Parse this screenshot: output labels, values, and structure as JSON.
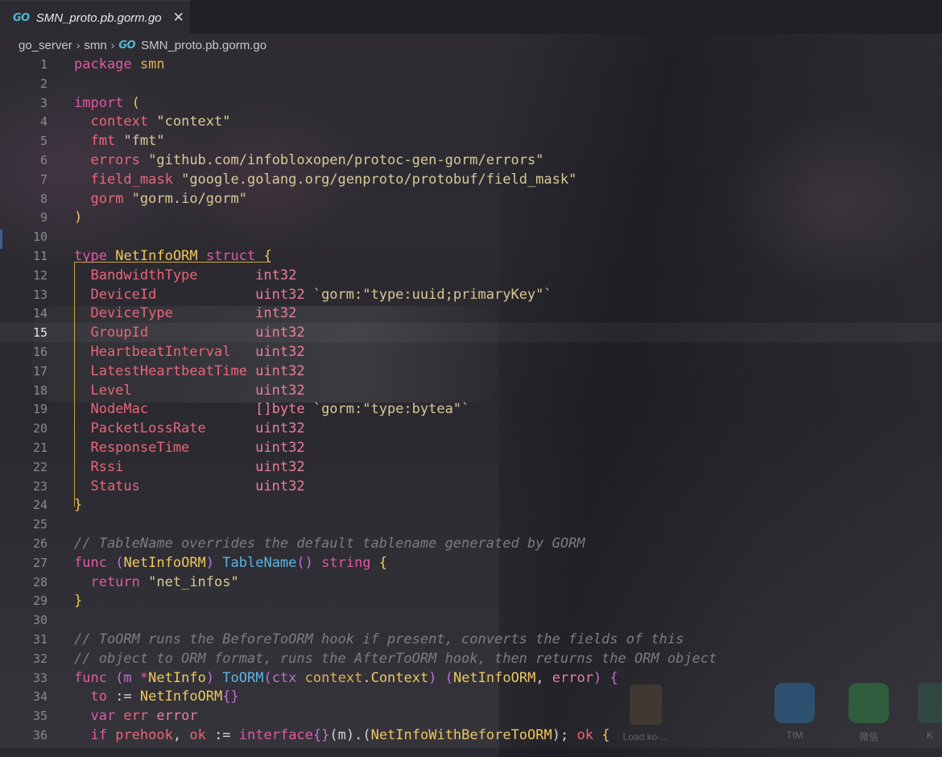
{
  "tab": {
    "icon": "go-file-icon",
    "label": "SMN_proto.pb.gorm.go",
    "close_label": "✕"
  },
  "breadcrumb": {
    "parts": [
      "go_server",
      "smn",
      "SMN_proto.pb.gorm.go"
    ]
  },
  "editor": {
    "active_line": 15,
    "line_numbers": [
      "1",
      "2",
      "3",
      "4",
      "5",
      "6",
      "7",
      "8",
      "9",
      "10",
      "11",
      "12",
      "13",
      "14",
      "15",
      "16",
      "17",
      "18",
      "19",
      "20",
      "21",
      "22",
      "23",
      "24",
      "25",
      "26",
      "27",
      "28",
      "29",
      "30",
      "31",
      "32",
      "33",
      "34",
      "35",
      "36"
    ]
  },
  "code": {
    "l1": [
      "package",
      " ",
      "smn"
    ],
    "l3": [
      "import",
      " ",
      "("
    ],
    "l4": [
      "  context",
      " ",
      "\"context\""
    ],
    "l5": [
      "  fmt",
      " ",
      "\"fmt\""
    ],
    "l6": [
      "  errors",
      " ",
      "\"github.com/infobloxopen/protoc-gen-gorm/errors\""
    ],
    "l7": [
      "  field_mask",
      " ",
      "\"google.golang.org/genproto/protobuf/field_mask\""
    ],
    "l8": [
      "  gorm",
      " ",
      "\"gorm.io/gorm\""
    ],
    "l9": [
      ")"
    ],
    "l11": [
      "type",
      " ",
      "NetInfoORM",
      " ",
      "struct",
      " ",
      "{"
    ],
    "fields": [
      [
        "  BandwidthType       ",
        "int32",
        ""
      ],
      [
        "  DeviceId            ",
        "uint32",
        " `gorm:\"type:uuid;primaryKey\"`"
      ],
      [
        "  DeviceType          ",
        "int32",
        ""
      ],
      [
        "  GroupId             ",
        "uint32",
        ""
      ],
      [
        "  HeartbeatInterval   ",
        "uint32",
        ""
      ],
      [
        "  LatestHeartbeatTime ",
        "uint32",
        ""
      ],
      [
        "  Level               ",
        "uint32",
        ""
      ],
      [
        "  NodeMac             ",
        "[]byte",
        " `gorm:\"type:bytea\"`"
      ],
      [
        "  PacketLossRate      ",
        "uint32",
        ""
      ],
      [
        "  ResponseTime        ",
        "uint32",
        ""
      ],
      [
        "  Rssi                ",
        "uint32",
        ""
      ],
      [
        "  Status              ",
        "uint32",
        ""
      ]
    ],
    "l24": [
      "}"
    ],
    "l26": "// TableName overrides the default tablename generated by GORM",
    "l27": [
      "func",
      " (",
      "NetInfoORM",
      ") ",
      "TableName",
      "() ",
      "string",
      " {"
    ],
    "l28": [
      "  return",
      " ",
      "\"net_infos\""
    ],
    "l29": [
      "}"
    ],
    "l31": "// ToORM runs the BeforeToORM hook if present, converts the fields of this",
    "l32": "// object to ORM format, runs the AfterToORM hook, then returns the ORM object",
    "l33": [
      "func",
      " (m ",
      "*",
      "NetInfo",
      ") ",
      "ToORM",
      "(ctx ",
      "context",
      ".",
      "Context",
      ") (",
      "NetInfoORM",
      ", ",
      "error",
      ") {"
    ],
    "l34": [
      "  to",
      " := ",
      "NetInfoORM",
      "{}"
    ],
    "l35": [
      "  var",
      " err ",
      "error"
    ],
    "l36": [
      "  if",
      " ",
      "prehook",
      ", ",
      "ok",
      " := ",
      "interface",
      "{}",
      "(m).(",
      "NetInfoWithBeforeToORM",
      "); ",
      "ok",
      " {"
    ]
  },
  "desktop": {
    "shortcuts": [
      {
        "label": "Load.ko-...",
        "icon": "file-icon",
        "color": "#6a5a3a"
      },
      {
        "label": "TIM",
        "icon": "tim-icon",
        "color": "#2f8fe0"
      },
      {
        "label": "微信",
        "icon": "wechat-icon",
        "color": "#2cb14a"
      },
      {
        "label": "K",
        "icon": "app-icon",
        "color": "#2d6e4d"
      }
    ]
  }
}
